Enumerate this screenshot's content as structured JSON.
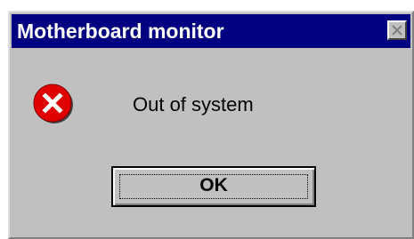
{
  "window": {
    "title": "Motherboard monitor",
    "close_icon": "close-icon"
  },
  "dialog": {
    "icon": "error-icon",
    "message": "Out of system",
    "ok_label": "OK"
  },
  "colors": {
    "titlebar": "#000080",
    "title_text": "#ffffff",
    "dialog_face": "#c0c0c0",
    "error_red": "#e00000"
  }
}
